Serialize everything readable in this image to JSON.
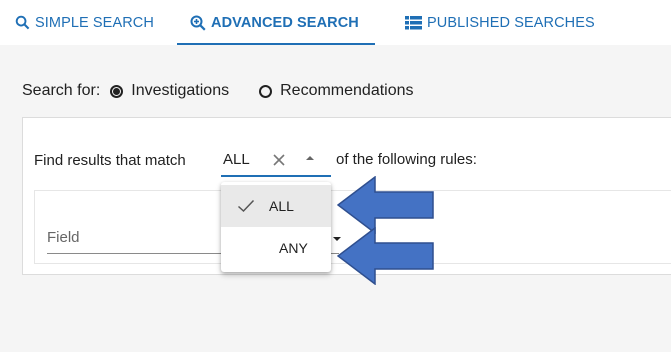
{
  "tabs": [
    {
      "label": "Simple Search",
      "icon": "search-icon"
    },
    {
      "label": "Advanced Search",
      "icon": "zoom-in-icon"
    },
    {
      "label": "Published Searches",
      "icon": "list-icon"
    }
  ],
  "search_for": {
    "label": "Search for:",
    "options": [
      {
        "label": "Investigations",
        "selected": true
      },
      {
        "label": "Recommendations",
        "selected": false
      }
    ]
  },
  "rule": {
    "prefix": "Find results that match",
    "value": "ALL",
    "suffix": "of the following rules:"
  },
  "field": {
    "label": "Field"
  },
  "dropdown": {
    "items": [
      {
        "label": "ALL",
        "selected": true
      },
      {
        "label": "ANY",
        "selected": false
      }
    ]
  },
  "colors": {
    "accent": "#1f6fb5",
    "arrow_fill": "#4472c4",
    "arrow_stroke": "#2f4f8f"
  }
}
